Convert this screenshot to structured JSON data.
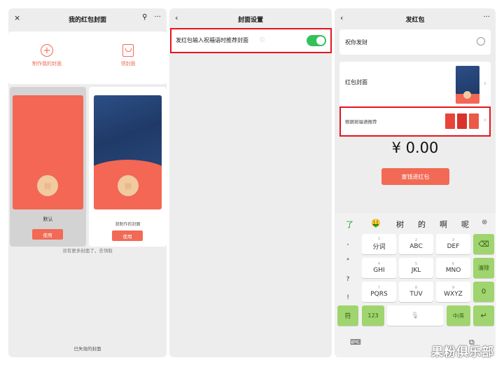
{
  "panel1": {
    "title": "我的红包封面",
    "close_icon": "×",
    "search_icon": "⚲",
    "more_icon": "···",
    "make_cover_label": "制作我的封面",
    "get_cover_label": "领封面",
    "default_label": "默认",
    "default_use_label": "使用",
    "custom_label": "我制作的封面",
    "custom_use_label": "使用",
    "no_more_text": "没有更多封面了，去领取",
    "expired_link": "已失效的封面",
    "seal_char": "開"
  },
  "panel2": {
    "back_icon": "‹",
    "title": "封面设置",
    "setting_label": "发红包输入祝福语时推荐封面",
    "info_icon": "ⓘ",
    "toggle_on": true
  },
  "panel3": {
    "back_icon": "‹",
    "title": "发红包",
    "more_icon": "···",
    "greeting": "祝你发财",
    "cover_label": "红包封面",
    "recommend_label": "根据祝福语推荐",
    "amount": "¥ 0.00",
    "submit_label": "塞钱进红包",
    "chevron": "›"
  },
  "keyboard": {
    "candidates": [
      "了",
      "🤑",
      "树",
      "的",
      "啊",
      "呢"
    ],
    "candidate_delete_icon": "⊗",
    "punct": [
      ",",
      "°",
      "?",
      "!"
    ],
    "rows": [
      [
        {
          "num": "1",
          "label": "分词"
        },
        {
          "num": "2",
          "label": "ABC"
        },
        {
          "num": "3",
          "label": "DEF"
        }
      ],
      [
        {
          "num": "4",
          "label": "GHI"
        },
        {
          "num": "5",
          "label": "JKL"
        },
        {
          "num": "6",
          "label": "MNO"
        }
      ],
      [
        {
          "num": "7",
          "label": "PQRS"
        },
        {
          "num": "8",
          "label": "TUV"
        },
        {
          "num": "9",
          "label": "WXYZ"
        }
      ]
    ],
    "backspace_icon": "⌫",
    "clear_label": "清除",
    "zero_label": "0",
    "symbol_label": "符",
    "num_label": "123",
    "space_icon": "🎙",
    "lang_label": "中/英",
    "enter_icon": "↵",
    "keyboard_icon": "⌨",
    "switch_icon": "⧉"
  },
  "watermark": "果粉俱乐部",
  "colors": {
    "accent": "#f26a55",
    "highlight": "#e5141e",
    "toggle": "#34c05a",
    "key_green": "#9fd46e"
  }
}
